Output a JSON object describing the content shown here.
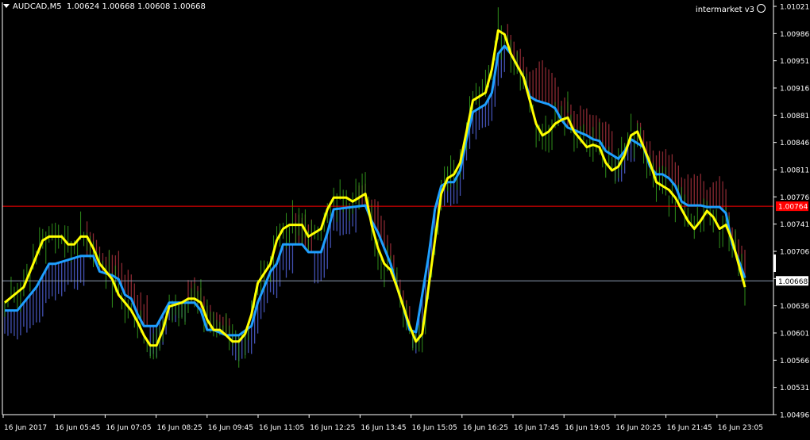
{
  "header": {
    "symbol": "AUDCAD,M5",
    "ohlc": "1.00624 1.00668 1.00608 1.00668"
  },
  "indicator": {
    "name": "intermarket v3"
  },
  "colors": {
    "background": "#000000",
    "axis": "#ffffff",
    "yellow_line": "#ffff00",
    "blue_line": "#1e9fff",
    "up_bars": "#2f8f1a",
    "down_bars_red": "#a0303a",
    "down_bars_blue": "#4e5fd0",
    "red_hline": "#ff0000",
    "grey_hline": "#8b9bb0",
    "price_label_red_bg": "#ff0000",
    "price_label_white_bg": "#ffffff"
  },
  "chart_data": {
    "type": "line",
    "grid": false,
    "ylim": [
      1.00496,
      1.01021
    ],
    "y_ticks": [
      "1.01021",
      "1.00986",
      "1.00951",
      "1.00916",
      "1.00881",
      "1.00846",
      "1.00811",
      "1.00776",
      "1.00741",
      "1.00706",
      "1.00671",
      "1.00636",
      "1.00601",
      "1.00566",
      "1.00531",
      "1.00496"
    ],
    "x_ticks": [
      "16 Jun 2017",
      "16 Jun 05:45",
      "16 Jun 07:05",
      "16 Jun 08:25",
      "16 Jun 09:45",
      "16 Jun 11:05",
      "16 Jun 12:25",
      "16 Jun 13:45",
      "16 Jun 15:05",
      "16 Jun 16:25",
      "16 Jun 17:45",
      "16 Jun 19:05",
      "16 Jun 20:25",
      "16 Jun 21:45",
      "16 Jun 23:05"
    ],
    "bar_count": 235,
    "h_lines": [
      {
        "value": 1.00764,
        "label": "1.00764",
        "color": "red"
      },
      {
        "value": 1.00668,
        "label": "1.00668",
        "color": "grey"
      }
    ],
    "series": [
      {
        "role": "yellow",
        "points": [
          [
            0,
            1.0064
          ],
          [
            3,
            1.0065
          ],
          [
            6,
            1.0066
          ],
          [
            8,
            1.0068
          ],
          [
            12,
            1.0072
          ],
          [
            14,
            1.00725
          ],
          [
            18,
            1.00725
          ],
          [
            20,
            1.00715
          ],
          [
            22,
            1.00715
          ],
          [
            24,
            1.00725
          ],
          [
            26,
            1.00725
          ],
          [
            28,
            1.0071
          ],
          [
            30,
            1.0069
          ],
          [
            32,
            1.0068
          ],
          [
            34,
            1.0067
          ],
          [
            36,
            1.0065
          ],
          [
            38,
            1.0064
          ],
          [
            40,
            1.0063
          ],
          [
            42,
            1.00615
          ],
          [
            44,
            1.00598
          ],
          [
            46,
            1.00585
          ],
          [
            48,
            1.00585
          ],
          [
            50,
            1.00605
          ],
          [
            52,
            1.00635
          ],
          [
            56,
            1.0064
          ],
          [
            58,
            1.00645
          ],
          [
            60,
            1.00645
          ],
          [
            62,
            1.0064
          ],
          [
            64,
            1.00618
          ],
          [
            66,
            1.00605
          ],
          [
            68,
            1.00605
          ],
          [
            70,
            1.00598
          ],
          [
            72,
            1.0059
          ],
          [
            74,
            1.0059
          ],
          [
            76,
            1.006
          ],
          [
            78,
            1.00625
          ],
          [
            80,
            1.00665
          ],
          [
            84,
            1.0069
          ],
          [
            86,
            1.0072
          ],
          [
            88,
            1.00735
          ],
          [
            90,
            1.0074
          ],
          [
            94,
            1.0074
          ],
          [
            96,
            1.00725
          ],
          [
            100,
            1.00735
          ],
          [
            102,
            1.0076
          ],
          [
            104,
            1.00775
          ],
          [
            108,
            1.00775
          ],
          [
            110,
            1.0077
          ],
          [
            112,
            1.00775
          ],
          [
            114,
            1.0078
          ],
          [
            116,
            1.0074
          ],
          [
            118,
            1.0071
          ],
          [
            120,
            1.0069
          ],
          [
            122,
            1.00682
          ],
          [
            124,
            1.0066
          ],
          [
            126,
            1.00635
          ],
          [
            128,
            1.0061
          ],
          [
            130,
            1.0059
          ],
          [
            132,
            1.006
          ],
          [
            134,
            1.0066
          ],
          [
            136,
            1.0072
          ],
          [
            138,
            1.0078
          ],
          [
            140,
            1.008
          ],
          [
            142,
            1.00805
          ],
          [
            144,
            1.0082
          ],
          [
            146,
            1.0086
          ],
          [
            148,
            1.009
          ],
          [
            150,
            1.00905
          ],
          [
            152,
            1.0091
          ],
          [
            154,
            1.0094
          ],
          [
            156,
            1.0099
          ],
          [
            158,
            1.00985
          ],
          [
            160,
            1.0096
          ],
          [
            162,
            1.00945
          ],
          [
            164,
            1.0093
          ],
          [
            166,
            1.009
          ],
          [
            168,
            1.0087
          ],
          [
            170,
            1.00855
          ],
          [
            172,
            1.0086
          ],
          [
            174,
            1.0087
          ],
          [
            176,
            1.00875
          ],
          [
            178,
            1.00878
          ],
          [
            180,
            1.0086
          ],
          [
            182,
            1.0085
          ],
          [
            184,
            1.0084
          ],
          [
            186,
            1.00843
          ],
          [
            188,
            1.0084
          ],
          [
            190,
            1.0082
          ],
          [
            192,
            1.0081
          ],
          [
            194,
            1.00815
          ],
          [
            196,
            1.0083
          ],
          [
            198,
            1.00855
          ],
          [
            200,
            1.0086
          ],
          [
            202,
            1.0084
          ],
          [
            204,
            1.0082
          ],
          [
            206,
            1.00795
          ],
          [
            208,
            1.0079
          ],
          [
            210,
            1.00785
          ],
          [
            212,
            1.00775
          ],
          [
            214,
            1.0076
          ],
          [
            216,
            1.00745
          ],
          [
            218,
            1.00735
          ],
          [
            220,
            1.00745
          ],
          [
            222,
            1.00758
          ],
          [
            224,
            1.0075
          ],
          [
            226,
            1.00735
          ],
          [
            228,
            1.0074
          ],
          [
            230,
            1.0072
          ],
          [
            232,
            1.0069
          ],
          [
            234,
            1.0066
          ]
        ]
      },
      {
        "role": "blue",
        "points": [
          [
            0,
            1.0063
          ],
          [
            4,
            1.0063
          ],
          [
            6,
            1.0064
          ],
          [
            10,
            1.0066
          ],
          [
            14,
            1.0069
          ],
          [
            16,
            1.0069
          ],
          [
            24,
            1.007
          ],
          [
            28,
            1.007
          ],
          [
            30,
            1.0068
          ],
          [
            34,
            1.00675
          ],
          [
            36,
            1.0067
          ],
          [
            38,
            1.0065
          ],
          [
            40,
            1.00645
          ],
          [
            42,
            1.00625
          ],
          [
            44,
            1.0061
          ],
          [
            48,
            1.0061
          ],
          [
            50,
            1.00625
          ],
          [
            52,
            1.0064
          ],
          [
            58,
            1.0064
          ],
          [
            60,
            1.0064
          ],
          [
            62,
            1.0063
          ],
          [
            64,
            1.00605
          ],
          [
            66,
            1.00605
          ],
          [
            70,
            1.00598
          ],
          [
            74,
            1.00598
          ],
          [
            78,
            1.0061
          ],
          [
            80,
            1.0064
          ],
          [
            84,
            1.0068
          ],
          [
            86,
            1.0069
          ],
          [
            88,
            1.00715
          ],
          [
            94,
            1.00715
          ],
          [
            96,
            1.00705
          ],
          [
            100,
            1.00705
          ],
          [
            102,
            1.0073
          ],
          [
            104,
            1.0076
          ],
          [
            110,
            1.00763
          ],
          [
            114,
            1.00765
          ],
          [
            116,
            1.00745
          ],
          [
            118,
            1.0073
          ],
          [
            120,
            1.0071
          ],
          [
            122,
            1.0069
          ],
          [
            124,
            1.0066
          ],
          [
            126,
            1.00635
          ],
          [
            128,
            1.00605
          ],
          [
            130,
            1.00602
          ],
          [
            132,
            1.0065
          ],
          [
            134,
            1.007
          ],
          [
            136,
            1.0076
          ],
          [
            138,
            1.0079
          ],
          [
            140,
            1.00795
          ],
          [
            142,
            1.00795
          ],
          [
            144,
            1.0081
          ],
          [
            146,
            1.0085
          ],
          [
            148,
            1.00885
          ],
          [
            150,
            1.0089
          ],
          [
            152,
            1.00895
          ],
          [
            154,
            1.0091
          ],
          [
            156,
            1.0096
          ],
          [
            158,
            1.0097
          ],
          [
            160,
            1.0096
          ],
          [
            162,
            1.00945
          ],
          [
            164,
            1.0093
          ],
          [
            166,
            1.00905
          ],
          [
            168,
            1.009
          ],
          [
            172,
            1.00895
          ],
          [
            174,
            1.0089
          ],
          [
            176,
            1.00875
          ],
          [
            178,
            1.00865
          ],
          [
            180,
            1.00862
          ],
          [
            184,
            1.00855
          ],
          [
            186,
            1.0085
          ],
          [
            188,
            1.00848
          ],
          [
            190,
            1.00835
          ],
          [
            192,
            1.0083
          ],
          [
            194,
            1.00825
          ],
          [
            196,
            1.00835
          ],
          [
            198,
            1.0085
          ],
          [
            202,
            1.0084
          ],
          [
            204,
            1.00815
          ],
          [
            206,
            1.00805
          ],
          [
            208,
            1.00805
          ],
          [
            210,
            1.008
          ],
          [
            212,
            1.0079
          ],
          [
            214,
            1.0077
          ],
          [
            216,
            1.00765
          ],
          [
            220,
            1.00765
          ],
          [
            222,
            1.00763
          ],
          [
            226,
            1.00763
          ],
          [
            228,
            1.00755
          ],
          [
            230,
            1.00715
          ],
          [
            232,
            1.00695
          ],
          [
            234,
            1.00672
          ]
        ]
      }
    ]
  }
}
